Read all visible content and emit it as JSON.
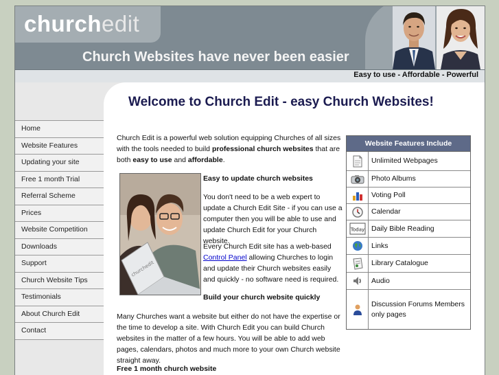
{
  "header": {
    "logo_main": "church",
    "logo_accent": "edit",
    "tagline": "Church Websites have never been easier",
    "subbar": "Easy to use - Affordable - Powerful"
  },
  "nav": [
    "Home",
    "Website Features",
    "Updating your site",
    "Free 1 month Trial",
    "Referral Scheme",
    "Prices",
    "Website Competition",
    "Downloads",
    "Support",
    "Church Website Tips",
    "Testimonials",
    "About Church Edit",
    "Contact"
  ],
  "main": {
    "title": "Welcome to Church Edit - easy Church Websites!",
    "intro_1": "Church Edit is a powerful web solution equipping Churches of all sizes with the tools needed to build ",
    "intro_bold_1": "professional church websites",
    "intro_2": " that are both ",
    "intro_bold_2": "easy to use",
    "intro_3": " and ",
    "intro_bold_3": "affordable",
    "intro_4": ".",
    "easy_heading": "Easy to update church websites",
    "easy_para": "You don't need to be a web expert to update a Church Edit Site - if you can use a computer then you will be able to use and update Church Edit for your Church website.",
    "panel_1": "Every Church Edit site has a web-based ",
    "panel_link": "Control Panel",
    "panel_2": " allowing Churches to login and update their Church websites easily and quickly - no software need is required.",
    "build_heading": "Build your church website quickly",
    "many_para": "Many Churches want a website but either do not have the expertise or the time to develop a site. With Church Edit you can build Church websites in the matter of a few hours. You will be able to add web pages, calendars, photos and much more to your own Church website straight away.",
    "free_heading": "Free 1 month church website",
    "photo_label": "churchedit"
  },
  "features": {
    "heading": "Website Features Include",
    "items": [
      {
        "label": "Unlimited Webpages",
        "icon": "page-icon"
      },
      {
        "label": "Photo Albums",
        "icon": "camera-icon"
      },
      {
        "label": "Voting Poll",
        "icon": "bar-chart-icon"
      },
      {
        "label": "Calendar",
        "icon": "clock-icon"
      },
      {
        "label": "Daily Bible Reading",
        "icon": "today-icon",
        "icon_text": "Today"
      },
      {
        "label": "Links",
        "icon": "globe-icon"
      },
      {
        "label": "Library Catalogue",
        "icon": "catalogue-icon"
      },
      {
        "label": "Audio",
        "icon": "speaker-icon"
      },
      {
        "label": "Discussion Forums Members only pages",
        "icon": "person-icon"
      }
    ]
  }
}
